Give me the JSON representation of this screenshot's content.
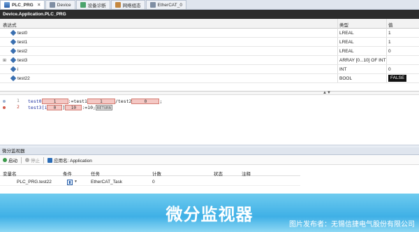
{
  "tabs": [
    {
      "label": "PLC_PRG",
      "icon": "program-icon",
      "active": true
    },
    {
      "label": "Device",
      "icon": "device-icon",
      "active": false
    },
    {
      "label": "设备诊断",
      "icon": "diagnostics-icon",
      "active": false
    },
    {
      "label": "网络组态",
      "icon": "network-icon",
      "active": false
    },
    {
      "label": "EtherCAT_0",
      "icon": "ethercat-icon",
      "active": false
    }
  ],
  "path": "Device.Application.PLC_PRG",
  "grid": {
    "headers": {
      "expression": "表达式",
      "type": "类型",
      "value": "值"
    },
    "rows": [
      {
        "name": "test0",
        "type": "LREAL",
        "value": "1",
        "expand": ""
      },
      {
        "name": "test1",
        "type": "LREAL",
        "value": "1",
        "expand": ""
      },
      {
        "name": "test2",
        "type": "LREAL",
        "value": "0",
        "expand": ""
      },
      {
        "name": "test3",
        "type": "ARRAY [0...10] OF INT",
        "value": "",
        "expand": "⊞"
      },
      {
        "name": "i",
        "type": "INT",
        "value": "0",
        "expand": ""
      },
      {
        "name": "test22",
        "type": "BOOL",
        "value": "FALSE",
        "expand": ""
      }
    ]
  },
  "code": {
    "line1": {
      "num": "1",
      "a": "test0",
      "a_val": "1",
      "op1": ":=test1",
      "b_val": "1",
      "op2": "/test2",
      "c_val": "0",
      "end": ";"
    },
    "line2": {
      "num": "2",
      "a": "test3[i",
      "a_val": "0",
      "op1": "]",
      "b_val": "10",
      "op2": ":=10;",
      "ret": "RETURN"
    }
  },
  "micro_monitor": {
    "title": "微分监视器",
    "start_label": "启动",
    "stop_label": "停止",
    "app_label": "应用名: Application",
    "headers": {
      "var": "变量名",
      "cond": "条件",
      "task": "任务",
      "count": "计数",
      "state": "状态",
      "comment": "注释"
    },
    "row": {
      "var": "PLC_PRG.test22",
      "task": "EtherCAT_Task",
      "count": "0",
      "state": "",
      "comment": ""
    }
  },
  "caption": {
    "title": "微分监视器",
    "credit": "图片发布者：无锡信捷电气股份有限公司"
  },
  "colors": {
    "accent_band": "#3fb0e6",
    "value_box": "#f4c8c4"
  }
}
